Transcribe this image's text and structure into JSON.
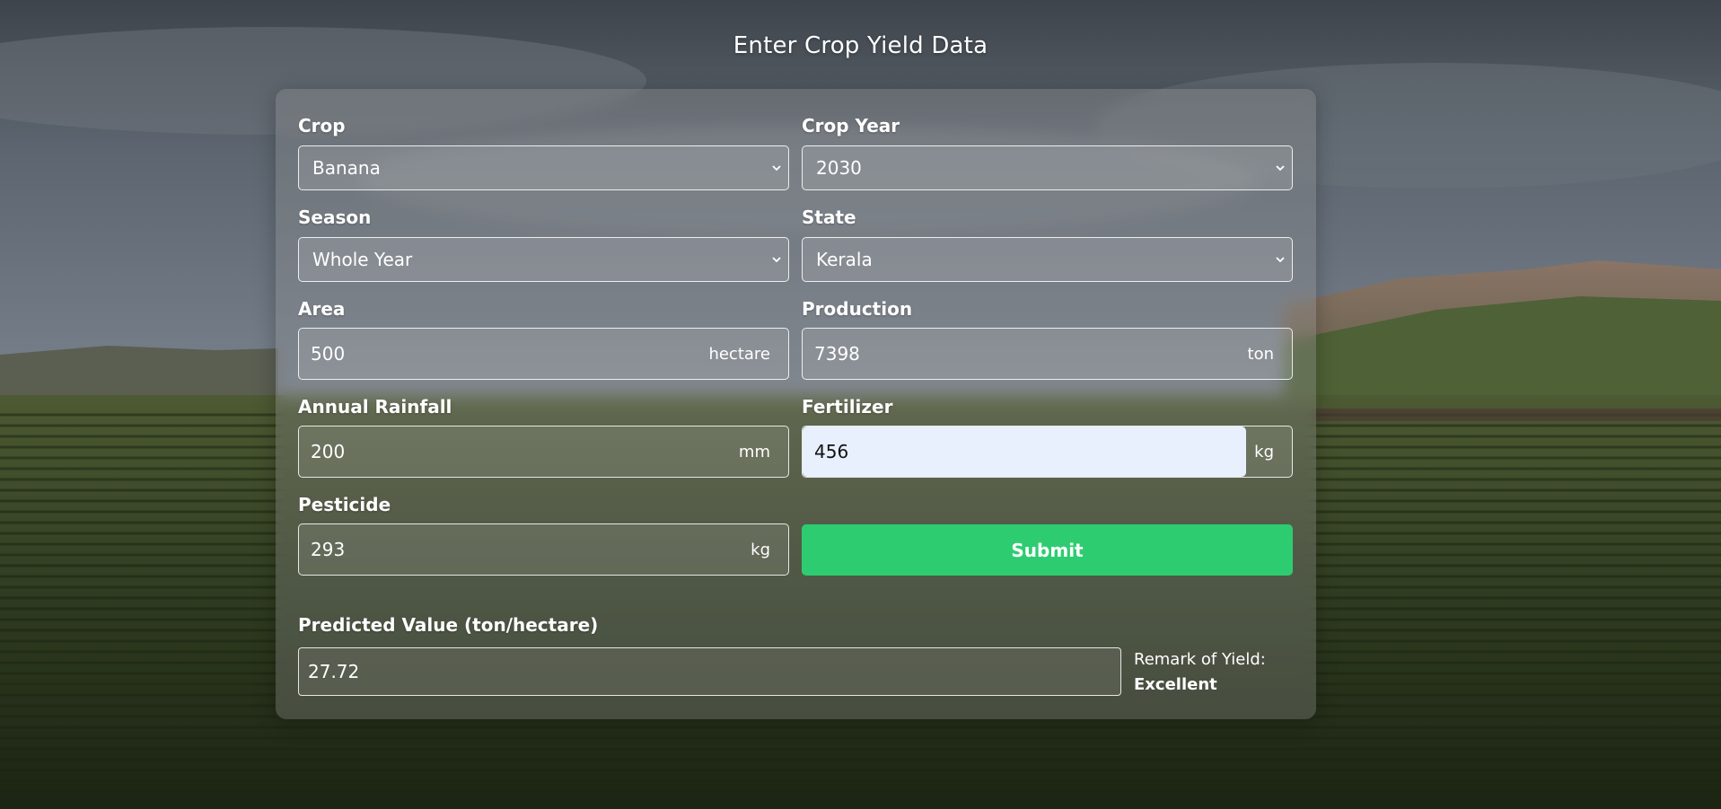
{
  "page": {
    "title": "Enter Crop Yield Data"
  },
  "form": {
    "crop": {
      "label": "Crop",
      "value": "Banana"
    },
    "crop_year": {
      "label": "Crop Year",
      "value": "2030"
    },
    "season": {
      "label": "Season",
      "value": "Whole Year"
    },
    "state": {
      "label": "State",
      "value": "Kerala"
    },
    "area": {
      "label": "Area",
      "value": "500",
      "unit": "hectare"
    },
    "production": {
      "label": "Production",
      "value": "7398",
      "unit": "ton"
    },
    "annual_rainfall": {
      "label": "Annual Rainfall",
      "value": "200",
      "unit": "mm"
    },
    "fertilizer": {
      "label": "Fertilizer",
      "value": "456",
      "unit": "kg"
    },
    "pesticide": {
      "label": "Pesticide",
      "value": "293",
      "unit": "kg"
    },
    "submit_label": "Submit"
  },
  "result": {
    "label": "Predicted Value (ton/hectare)",
    "value": "27.72",
    "remark_label": "Remark of Yield:",
    "remark_value": "Excellent"
  },
  "colors": {
    "submit": "#2ecc71",
    "focused_input": "#e8f0fe"
  },
  "icons": {
    "select_chevron": "chevron-down-icon"
  }
}
